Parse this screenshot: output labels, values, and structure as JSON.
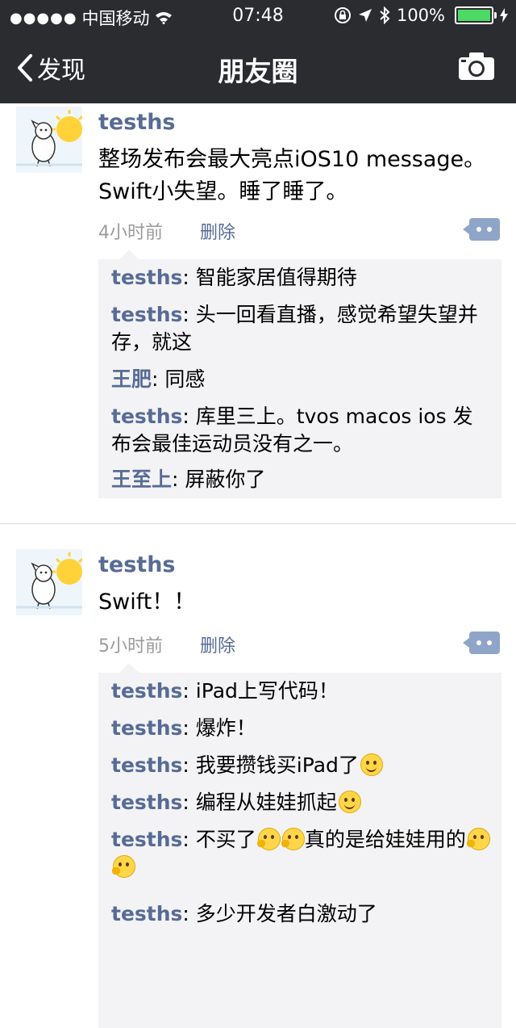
{
  "status_bar": {
    "carrier": "中国移动",
    "time": "07:48",
    "battery": "100%"
  },
  "nav": {
    "back_label": "发现",
    "title": "朋友圈"
  },
  "posts": [
    {
      "author": "tesths",
      "content": "整场发布会最大亮点iOS10 message。Swift小失望。睡了睡了。",
      "time": "4小时前",
      "delete_label": "删除",
      "comments": [
        {
          "author": "tesths",
          "sep": ": ",
          "text": "智能家居值得期待"
        },
        {
          "author": "tesths",
          "sep": ": ",
          "text": "头一回看直播，感觉希望失望并存，就这"
        },
        {
          "author": "王肥",
          "sep": ": ",
          "text": "同感"
        },
        {
          "author": "tesths",
          "sep": ": ",
          "text": "库里三上。tvos macos ios 发布会最佳运动员没有之一。"
        },
        {
          "author": "王至上",
          "sep": ": ",
          "text": "屏蔽你了"
        }
      ]
    },
    {
      "author": "tesths",
      "content": "Swift！！",
      "time": "5小时前",
      "delete_label": "删除",
      "comments": [
        {
          "author": "tesths",
          "sep": ": ",
          "text": "iPad上写代码！"
        },
        {
          "author": "tesths",
          "sep": ": ",
          "text": "爆炸！"
        },
        {
          "author": "tesths",
          "sep": ": ",
          "text": "我要攒钱买iPad了"
        },
        {
          "author": "tesths",
          "sep": ": ",
          "text": "编程从娃娃抓起"
        },
        {
          "author": "tesths",
          "sep": ": ",
          "text": "不买了"
        },
        {
          "author": "tesths",
          "sep": ": ",
          "text": "真的是给娃娃用的"
        },
        {
          "author": "tesths",
          "sep": ": ",
          "text": "多少开发者白激动了"
        }
      ]
    }
  ]
}
